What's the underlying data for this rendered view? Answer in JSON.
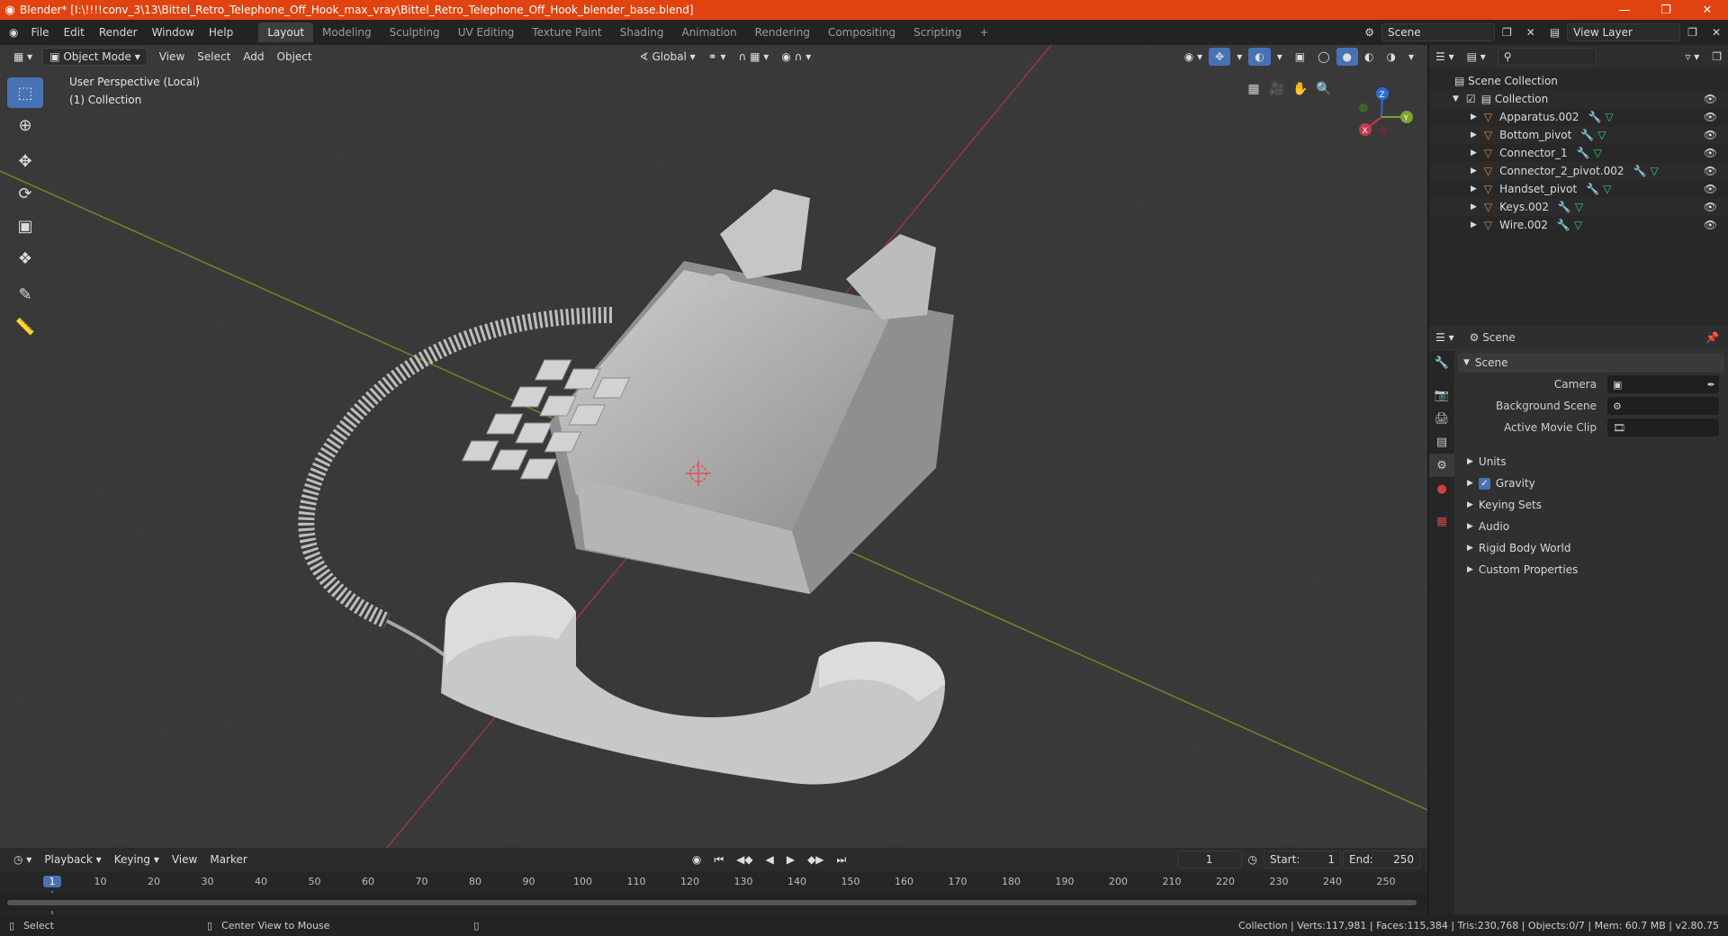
{
  "titlebar": {
    "title": "Blender* [I:\\!!!!conv_3\\13\\Bittel_Retro_Telephone_Off_Hook_max_vray\\Bittel_Retro_Telephone_Off_Hook_blender_base.blend]",
    "color": "#e0430f"
  },
  "menu": {
    "items": [
      "File",
      "Edit",
      "Render",
      "Window",
      "Help"
    ]
  },
  "workspaces": [
    "Layout",
    "Modeling",
    "Sculpting",
    "UV Editing",
    "Texture Paint",
    "Shading",
    "Animation",
    "Rendering",
    "Compositing",
    "Scripting"
  ],
  "active_workspace": "Layout",
  "scene_field": "Scene",
  "view_layer_field": "View Layer",
  "viewport": {
    "mode": "Object Mode",
    "menus": [
      "View",
      "Select",
      "Add",
      "Object"
    ],
    "transform_orientation": "Global",
    "perspective_label": "User Perspective (Local)",
    "collection_label": "(1) Collection",
    "gizmo": {
      "x": "X",
      "y": "Y",
      "z": "Z"
    },
    "accent": "#4772b3"
  },
  "outliner": {
    "root": "Scene Collection",
    "collection": "Collection",
    "objects": [
      "Apparatus.002",
      "Bottom_pivot",
      "Connector_1",
      "Connector_2_pivot.002",
      "Handset_pivot",
      "Keys.002",
      "Wire.002"
    ]
  },
  "properties": {
    "header": "Scene",
    "panel": "Scene",
    "fields": [
      {
        "label": "Camera"
      },
      {
        "label": "Background Scene"
      },
      {
        "label": "Active Movie Clip"
      }
    ],
    "sections": [
      "Units",
      "Gravity",
      "Keying Sets",
      "Audio",
      "Rigid Body World",
      "Custom Properties"
    ]
  },
  "timeline": {
    "menus": [
      "Playback",
      "Keying",
      "View",
      "Marker"
    ],
    "current_frame": "1",
    "start_label": "Start:",
    "start": "1",
    "end_label": "End:",
    "end": "250",
    "ruler": [
      "1",
      "10",
      "20",
      "30",
      "40",
      "50",
      "60",
      "70",
      "80",
      "90",
      "100",
      "110",
      "120",
      "130",
      "140",
      "150",
      "160",
      "170",
      "180",
      "190",
      "200",
      "210",
      "220",
      "230",
      "240",
      "250"
    ]
  },
  "statusbar": {
    "left_action": "Select",
    "mid_action": "Center View to Mouse",
    "stats": "Collection | Verts:117,981 | Faces:115,384 | Tris:230,768 | Objects:0/7 | Mem: 60.7 MB | v2.80.75"
  }
}
